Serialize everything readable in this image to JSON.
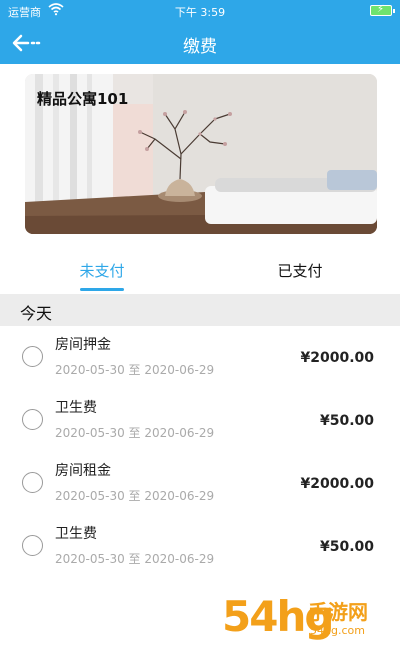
{
  "status_bar": {
    "carrier": "运营商",
    "time": "下午 3:59"
  },
  "nav": {
    "title": "缴费",
    "back_icon": "back-arrow-icon"
  },
  "banner": {
    "title": "精品公寓101"
  },
  "tabs": [
    {
      "label": "未支付",
      "active": true
    },
    {
      "label": "已支付",
      "active": false
    }
  ],
  "section": {
    "title": "今天"
  },
  "items": [
    {
      "name": "房间押金",
      "date": "2020-05-30 至 2020-06-29",
      "amount": "¥2000.00"
    },
    {
      "name": "卫生费",
      "date": "2020-05-30 至 2020-06-29",
      "amount": "¥50.00"
    },
    {
      "name": "房间租金",
      "date": "2020-05-30 至 2020-06-29",
      "amount": "¥2000.00"
    },
    {
      "name": "卫生费",
      "date": "2020-05-30 至 2020-06-29",
      "amount": "¥50.00"
    }
  ],
  "watermark": {
    "number": "54hg",
    "cn": "手游网",
    "url": "54hg.com"
  },
  "colors": {
    "accent": "#2ea7e8",
    "watermark": "#f3a01a"
  }
}
